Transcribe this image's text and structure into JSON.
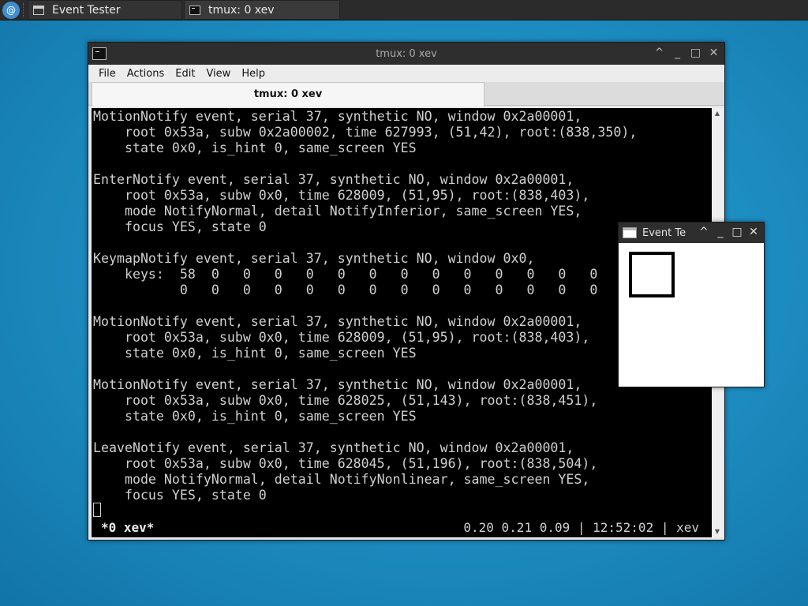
{
  "taskbar": {
    "start_icon": "debian-swirl-icon",
    "tasks": [
      {
        "label": "Event Tester",
        "icon": "window-icon"
      },
      {
        "label": "tmux: 0 xev",
        "icon": "terminal-icon"
      }
    ]
  },
  "terminal_window": {
    "title": "tmux: 0 xev",
    "controls": {
      "shade": "^",
      "minimize": "_",
      "maximize": "□",
      "close": "✕"
    },
    "menu": [
      "File",
      "Actions",
      "Edit",
      "View",
      "Help"
    ],
    "tab_label": "tmux: 0 xev",
    "lines": [
      "MotionNotify event, serial 37, synthetic NO, window 0x2a00001,",
      "    root 0x53a, subw 0x2a00002, time 627993, (51,42), root:(838,350),",
      "    state 0x0, is_hint 0, same_screen YES",
      "",
      "EnterNotify event, serial 37, synthetic NO, window 0x2a00001,",
      "    root 0x53a, subw 0x0, time 628009, (51,95), root:(838,403),",
      "    mode NotifyNormal, detail NotifyInferior, same_screen YES,",
      "    focus YES, state 0",
      "",
      "KeymapNotify event, serial 37, synthetic NO, window 0x0,",
      "    keys:  58  0   0   0   0   0   0   0   0   0   0   0   0   0",
      "           0   0   0   0   0   0   0   0   0   0   0   0   0   0",
      "",
      "MotionNotify event, serial 37, synthetic NO, window 0x2a00001,",
      "    root 0x53a, subw 0x0, time 628009, (51,95), root:(838,403),",
      "    state 0x0, is_hint 0, same_screen YES",
      "",
      "MotionNotify event, serial 37, synthetic NO, window 0x2a00001,",
      "    root 0x53a, subw 0x0, time 628025, (51,143), root:(838,451),",
      "    state 0x0, is_hint 0, same_screen YES",
      "",
      "LeaveNotify event, serial 37, synthetic NO, window 0x2a00001,",
      "    root 0x53a, subw 0x0, time 628045, (51,196), root:(838,504),",
      "    mode NotifyNormal, detail NotifyNonlinear, same_screen YES,",
      "    focus YES, state 0"
    ],
    "status": {
      "left": "*0 xev*",
      "right": "0.20 0.21 0.09 | 12:52:02 | xev"
    }
  },
  "event_window": {
    "title": "Event Te",
    "controls": {
      "shade": "^",
      "minimize": "_",
      "maximize": "□",
      "close": "✕"
    }
  },
  "colors": {
    "desktop": "#1e90c4",
    "titlebar": "#2e2e2e",
    "terminal_bg": "#000000",
    "terminal_fg": "#d0d0d0"
  }
}
